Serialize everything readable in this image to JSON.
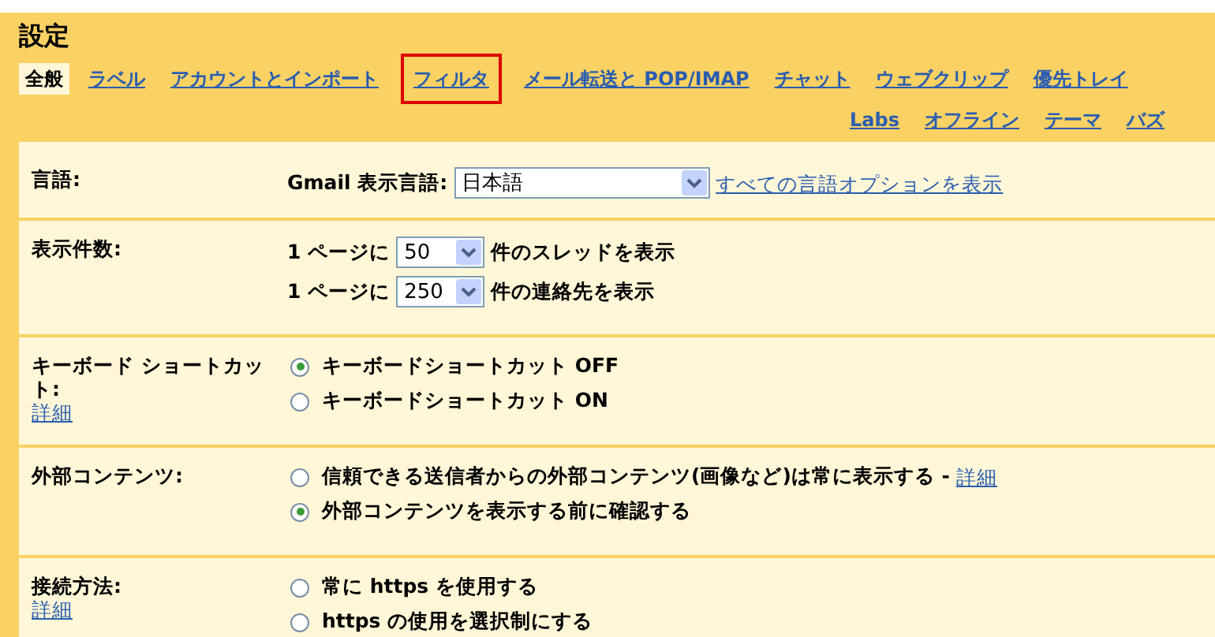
{
  "title": "設定",
  "tabs": [
    {
      "label": "全般",
      "selected": true,
      "highlighted": false
    },
    {
      "label": "ラベル",
      "selected": false,
      "highlighted": false
    },
    {
      "label": "アカウントとインポート",
      "selected": false,
      "highlighted": false
    },
    {
      "label": "フィルタ",
      "selected": false,
      "highlighted": true
    },
    {
      "label": "メール転送と POP/IMAP",
      "selected": false,
      "highlighted": false
    },
    {
      "label": "チャット",
      "selected": false,
      "highlighted": false
    },
    {
      "label": "ウェブクリップ",
      "selected": false,
      "highlighted": false
    },
    {
      "label": "優先トレイ",
      "selected": false,
      "highlighted": false
    }
  ],
  "tabs_second_row": [
    {
      "label": "Labs",
      "selected": false,
      "highlighted": false
    },
    {
      "label": "オフライン",
      "selected": false,
      "highlighted": false
    },
    {
      "label": "テーマ",
      "selected": false,
      "highlighted": false
    },
    {
      "label": "バズ",
      "selected": false,
      "highlighted": false
    }
  ],
  "sections": [
    {
      "kind": "language",
      "label": "言語:",
      "field_label": "Gmail 表示言語:",
      "select_value": "日本語",
      "link": "すべての言語オプションを表示"
    },
    {
      "kind": "counts",
      "label": "表示件数:",
      "lines": [
        {
          "prefix": "1 ページに",
          "value": "50",
          "suffix": "件のスレッドを表示"
        },
        {
          "prefix": "1 ページに",
          "value": "250",
          "suffix": "件の連絡先を表示"
        }
      ]
    },
    {
      "kind": "radios",
      "label": "キーボード ショートカット:",
      "help_link": "詳細",
      "options": [
        {
          "label": "キーボードショートカット OFF",
          "selected": true
        },
        {
          "label": "キーボードショートカット ON",
          "selected": false
        }
      ]
    },
    {
      "kind": "radios",
      "label": "外部コンテンツ:",
      "options": [
        {
          "label": "信頼できる送信者からの外部コンテンツ(画像など)は常に表示する -",
          "link": "詳細",
          "selected": false
        },
        {
          "label": "外部コンテンツを表示する前に確認する",
          "selected": true
        }
      ]
    },
    {
      "kind": "radios",
      "label": "接続方法:",
      "help_link": "詳細",
      "options": [
        {
          "label": "常に https を使用する",
          "selected": false
        },
        {
          "label": "https の使用を選択制にする",
          "selected": false
        }
      ]
    }
  ]
}
